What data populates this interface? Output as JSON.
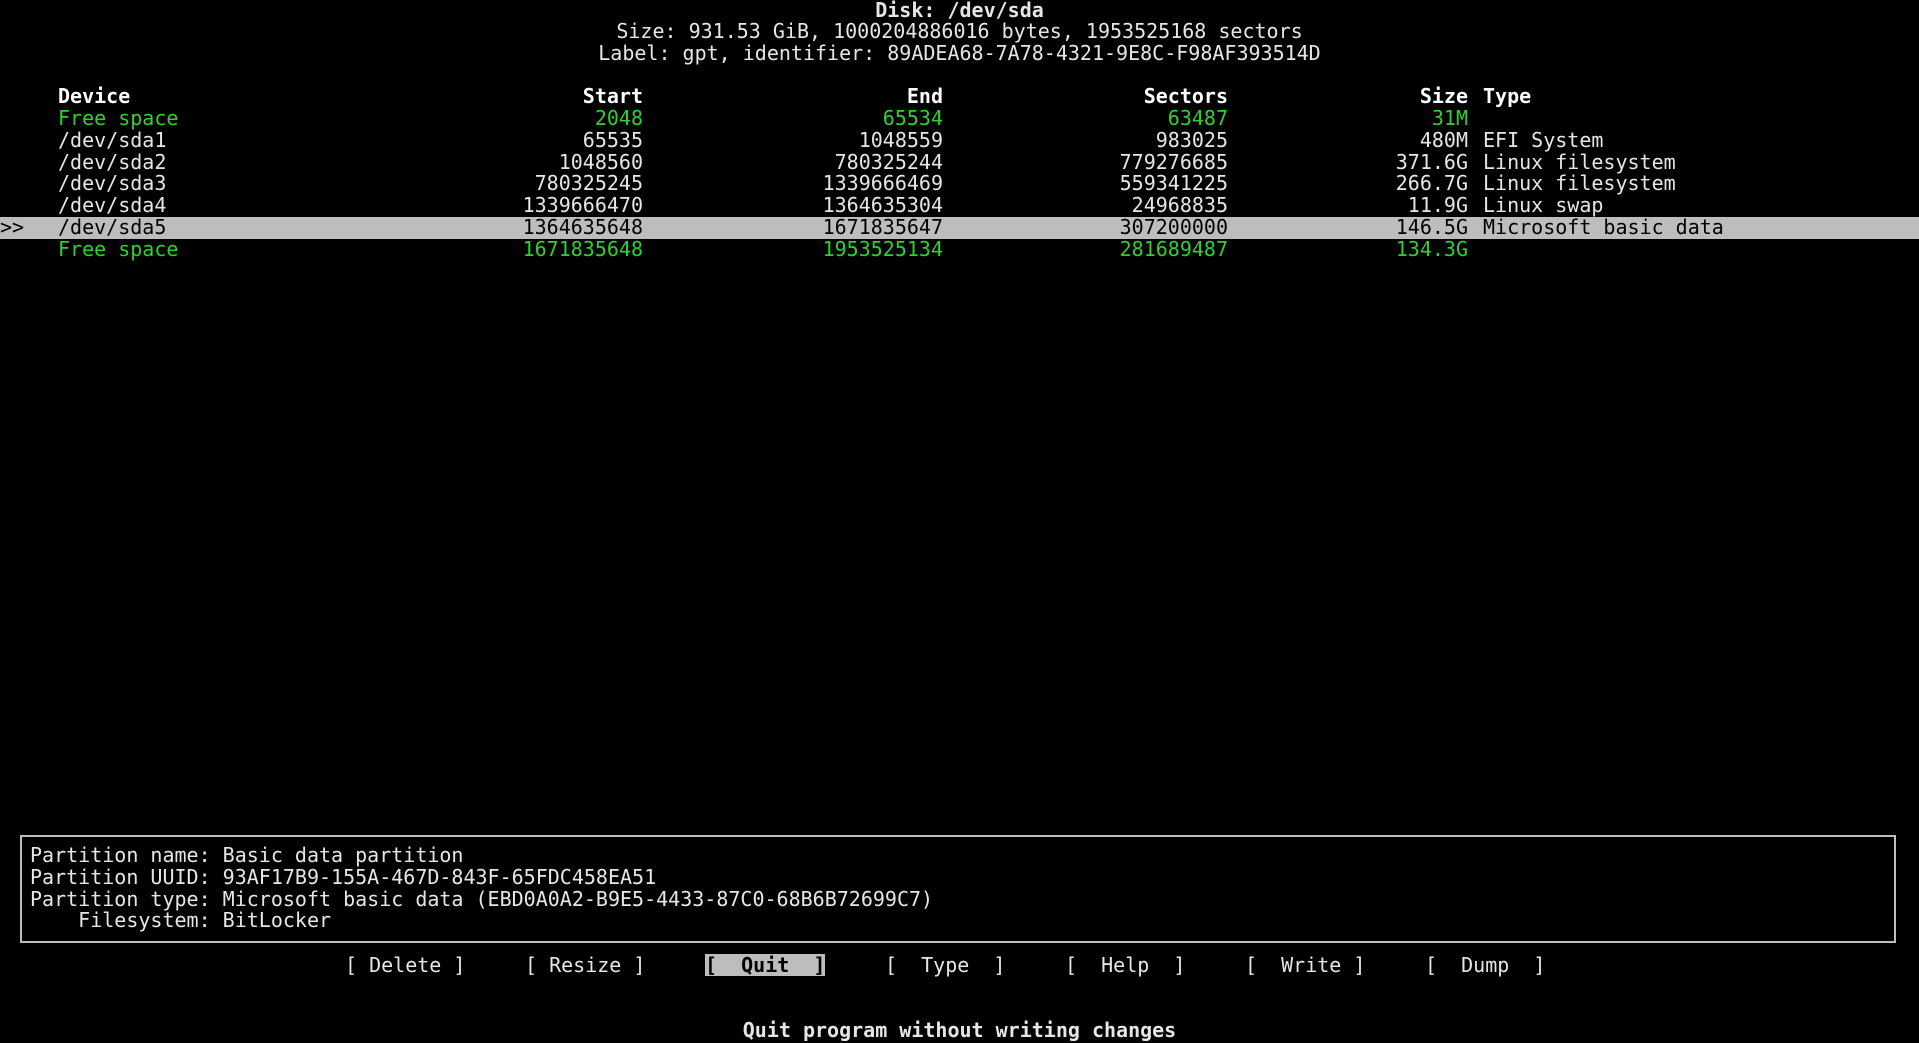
{
  "header": {
    "disk": "Disk: /dev/sda",
    "size": "Size: 931.53 GiB, 1000204886016 bytes, 1953525168 sectors",
    "label": "Label: gpt, identifier: 89ADEA68-7A78-4321-9E8C-F98AF393514D"
  },
  "table": {
    "columns": {
      "device": "Device",
      "start": "Start",
      "end": "End",
      "sectors": "Sectors",
      "size": "Size",
      "type": "Type"
    },
    "cursor": ">>",
    "rows": [
      {
        "device": "Free space",
        "start": "2048",
        "end": "65534",
        "sectors": "63487",
        "size": "31M",
        "type": "",
        "free": true
      },
      {
        "device": "/dev/sda1",
        "start": "65535",
        "end": "1048559",
        "sectors": "983025",
        "size": "480M",
        "type": "EFI System"
      },
      {
        "device": "/dev/sda2",
        "start": "1048560",
        "end": "780325244",
        "sectors": "779276685",
        "size": "371.6G",
        "type": "Linux filesystem"
      },
      {
        "device": "/dev/sda3",
        "start": "780325245",
        "end": "1339666469",
        "sectors": "559341225",
        "size": "266.7G",
        "type": "Linux filesystem"
      },
      {
        "device": "/dev/sda4",
        "start": "1339666470",
        "end": "1364635304",
        "sectors": "24968835",
        "size": "11.9G",
        "type": "Linux swap"
      },
      {
        "device": "/dev/sda5",
        "start": "1364635648",
        "end": "1671835647",
        "sectors": "307200000",
        "size": "146.5G",
        "type": "Microsoft basic data",
        "selected": true
      },
      {
        "device": "Free space",
        "start": "1671835648",
        "end": "1953525134",
        "sectors": "281689487",
        "size": "134.3G",
        "type": "",
        "free": true
      }
    ]
  },
  "info": {
    "name": "Partition name: Basic data partition",
    "uuid": "Partition UUID: 93AF17B9-155A-467D-843F-65FDC458EA51",
    "ptype": "Partition type: Microsoft basic data (EBD0A0A2-B9E5-4433-87C0-68B6B72699C7)",
    "fs": "    Filesystem: BitLocker"
  },
  "menu": {
    "delete": "[ Delete ]",
    "resize": "[ Resize ]",
    "quit": "[  Quit  ]",
    "type": "[  Type  ]",
    "help": "[  Help  ]",
    "write": "[  Write ]",
    "dump": "[  Dump  ]"
  },
  "status": "Quit program without writing changes",
  "colors": {
    "background": "#000000",
    "foreground": "#e6e6e6",
    "free_space": "#2fd12f",
    "selection": "#bdbdbd"
  }
}
